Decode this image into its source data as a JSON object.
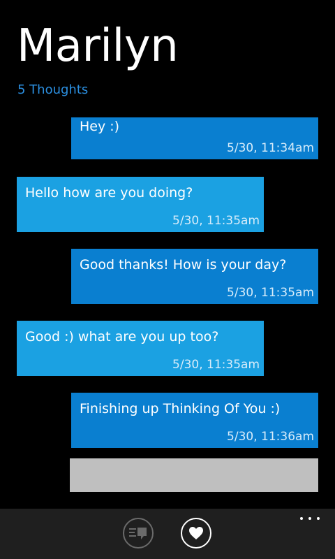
{
  "header": {
    "title": "Marilyn",
    "subtitle": "5 Thoughts"
  },
  "messages": [
    {
      "direction": "sent",
      "text": "Hey :)",
      "time": "5/30, 11:34am"
    },
    {
      "direction": "received",
      "text": "Hello how are you doing?",
      "time": "5/30, 11:35am"
    },
    {
      "direction": "sent",
      "text": "Good thanks! How is your day?",
      "time": "5/30, 11:35am"
    },
    {
      "direction": "received",
      "text": "Good :) what are you up too?",
      "time": "5/30, 11:35am"
    },
    {
      "direction": "sent",
      "text": "Finishing up Thinking Of You :)",
      "time": "5/30, 11:36am"
    }
  ],
  "compose": {
    "value": ""
  },
  "appbar": {
    "buttons": [
      {
        "icon": "chat-icon",
        "state": "inactive"
      },
      {
        "icon": "heart-icon",
        "state": "active"
      }
    ],
    "more_icon": "ellipsis-icon"
  },
  "colors": {
    "accent": "#2b8fe0",
    "sent_bubble": "#0a7fd0",
    "received_bubble": "#1ba1e2",
    "compose_box": "#bfbfbf",
    "appbar": "#1f1f1f"
  }
}
